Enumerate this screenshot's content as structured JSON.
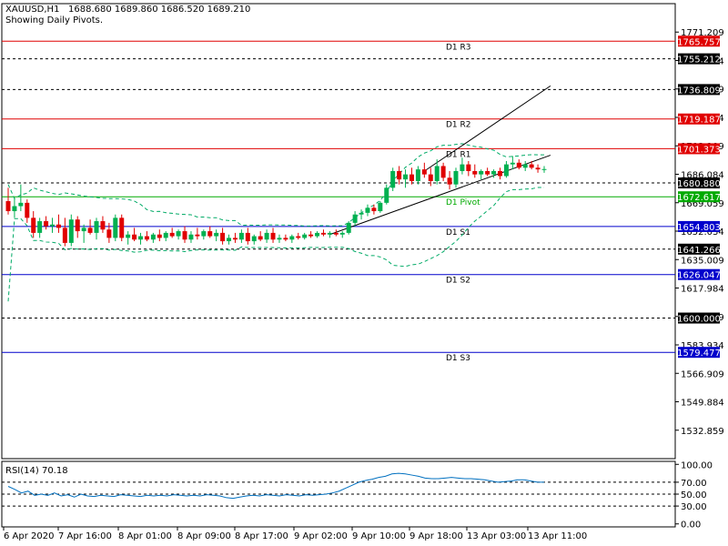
{
  "header": {
    "symbol": "XAUUSD,H1",
    "ohlc": "1688.680 1689.860 1686.520 1689.210",
    "note": "Showing Daily Pivots."
  },
  "indicator": {
    "label": "RSI(14) 70.18"
  },
  "colors": {
    "bull": "#00b050",
    "bear": "#e00000",
    "resistance": "#e00000",
    "support": "#0000cc",
    "pivot": "#00aa00",
    "dashed": "#000000",
    "band": "#00aa66",
    "rsi": "#0070c0"
  },
  "chart_data": [
    {
      "type": "candlestick",
      "title": "XAUUSD,H1",
      "ylim": [
        1515.84,
        1788.23
      ],
      "y_ticks": [
        "1771.209",
        "1754.184",
        "1737.159",
        "1720.134",
        "1703.109",
        "1686.084",
        "1669.059",
        "1652.034",
        "1635.009",
        "1617.984",
        "1600.959",
        "1583.934",
        "1566.909",
        "1549.884",
        "1532.859"
      ],
      "x_tick_labels": [
        "6 Apr 2020",
        "7 Apr 16:00",
        "8 Apr 01:00",
        "8 Apr 09:00",
        "8 Apr 17:00",
        "9 Apr 02:00",
        "9 Apr 10:00",
        "9 Apr 18:00",
        "13 Apr 03:00",
        "13 Apr 11:00"
      ],
      "pivot_levels": [
        {
          "name": "D1 R3",
          "value": 1765.757,
          "kind": "resistance"
        },
        {
          "name": "D1 R2",
          "value": 1719.187,
          "kind": "resistance"
        },
        {
          "name": "D1 R1",
          "value": 1701.373,
          "kind": "resistance"
        },
        {
          "name": "D1 Pivot",
          "value": 1672.617,
          "kind": "pivot"
        },
        {
          "name": "D1 S1",
          "value": 1654.803,
          "kind": "support"
        },
        {
          "name": "D1 S2",
          "value": 1626.047,
          "kind": "support"
        },
        {
          "name": "D1 S3",
          "value": 1579.477,
          "kind": "support"
        }
      ],
      "dashed_levels": [
        "1755.212",
        "1736.809",
        "1680.880",
        "1641.266",
        "1600.000"
      ],
      "candles": [
        [
          1670.0,
          1678.0,
          1662.0,
          1664.0
        ],
        [
          1664.0,
          1672.0,
          1660.0,
          1667.0
        ],
        [
          1667.0,
          1680.0,
          1664.0,
          1669.0
        ],
        [
          1669.0,
          1671.0,
          1657.0,
          1660.0
        ],
        [
          1660.0,
          1664.0,
          1648.0,
          1651.0
        ],
        [
          1651.0,
          1660.0,
          1648.0,
          1658.0
        ],
        [
          1658.0,
          1661.0,
          1653.0,
          1655.0
        ],
        [
          1655.0,
          1660.0,
          1651.0,
          1656.0
        ],
        [
          1656.0,
          1662.0,
          1651.0,
          1654.0
        ],
        [
          1654.0,
          1660.0,
          1643.0,
          1645.0
        ],
        [
          1645.0,
          1662.0,
          1643.0,
          1659.0
        ],
        [
          1659.0,
          1661.0,
          1648.0,
          1652.0
        ],
        [
          1652.0,
          1656.0,
          1645.0,
          1654.0
        ],
        [
          1654.0,
          1659.0,
          1650.0,
          1651.0
        ],
        [
          1651.0,
          1660.0,
          1647.0,
          1658.0
        ],
        [
          1658.0,
          1661.0,
          1651.0,
          1653.0
        ],
        [
          1653.0,
          1657.0,
          1645.0,
          1648.0
        ],
        [
          1648.0,
          1662.0,
          1646.0,
          1660.0
        ],
        [
          1660.0,
          1662.0,
          1646.0,
          1648.0
        ],
        [
          1648.0,
          1652.0,
          1644.0,
          1650.0
        ],
        [
          1650.0,
          1654.0,
          1646.0,
          1647.0
        ],
        [
          1647.0,
          1651.0,
          1644.0,
          1649.0
        ],
        [
          1649.0,
          1652.0,
          1646.0,
          1647.0
        ],
        [
          1647.0,
          1651.0,
          1645.0,
          1650.0
        ],
        [
          1650.0,
          1653.0,
          1646.0,
          1648.0
        ],
        [
          1648.0,
          1652.0,
          1646.0,
          1651.0
        ],
        [
          1651.0,
          1654.0,
          1648.0,
          1649.0
        ],
        [
          1649.0,
          1653.0,
          1647.0,
          1652.0
        ],
        [
          1652.0,
          1655.0,
          1645.0,
          1647.0
        ],
        [
          1647.0,
          1652.0,
          1645.0,
          1650.0
        ],
        [
          1650.0,
          1654.0,
          1647.0,
          1649.0
        ],
        [
          1649.0,
          1653.0,
          1647.0,
          1652.0
        ],
        [
          1652.0,
          1655.0,
          1648.0,
          1649.0
        ],
        [
          1649.0,
          1653.0,
          1646.0,
          1651.0
        ],
        [
          1651.0,
          1654.0,
          1644.0,
          1646.0
        ],
        [
          1646.0,
          1650.0,
          1644.0,
          1648.0
        ],
        [
          1648.0,
          1651.0,
          1645.0,
          1647.0
        ],
        [
          1647.0,
          1653.0,
          1645.0,
          1651.0
        ],
        [
          1651.0,
          1654.0,
          1644.0,
          1646.0
        ],
        [
          1646.0,
          1650.0,
          1644.0,
          1649.0
        ],
        [
          1649.0,
          1652.0,
          1646.0,
          1647.0
        ],
        [
          1647.0,
          1653.0,
          1645.0,
          1651.0
        ],
        [
          1651.0,
          1654.0,
          1645.0,
          1647.0
        ],
        [
          1647.0,
          1650.0,
          1645.0,
          1648.0
        ],
        [
          1648.0,
          1650.0,
          1646.0,
          1647.0
        ],
        [
          1647.0,
          1650.0,
          1645.0,
          1649.0
        ],
        [
          1649.0,
          1651.0,
          1647.0,
          1648.0
        ],
        [
          1648.0,
          1651.0,
          1647.0,
          1650.0
        ],
        [
          1650.0,
          1652.0,
          1648.0,
          1649.0
        ],
        [
          1649.0,
          1652.0,
          1648.0,
          1651.0
        ],
        [
          1651.0,
          1653.0,
          1649.0,
          1650.0
        ],
        [
          1650.0,
          1652.0,
          1648.0,
          1651.0
        ],
        [
          1651.0,
          1653.0,
          1649.0,
          1650.0
        ],
        [
          1650.0,
          1652.0,
          1648.0,
          1651.0
        ],
        [
          1651.0,
          1658.0,
          1650.0,
          1657.0
        ],
        [
          1657.0,
          1664.0,
          1655.0,
          1662.0
        ],
        [
          1662.0,
          1665.0,
          1659.0,
          1663.0
        ],
        [
          1663.0,
          1668.0,
          1661.0,
          1666.0
        ],
        [
          1666.0,
          1668.0,
          1662.0,
          1664.0
        ],
        [
          1664.0,
          1670.0,
          1663.0,
          1669.0
        ],
        [
          1669.0,
          1680.0,
          1668.0,
          1678.0
        ],
        [
          1678.0,
          1690.0,
          1676.0,
          1688.0
        ],
        [
          1688.0,
          1691.0,
          1680.0,
          1683.0
        ],
        [
          1683.0,
          1689.0,
          1678.0,
          1686.0
        ],
        [
          1686.0,
          1690.0,
          1680.0,
          1682.0
        ],
        [
          1682.0,
          1691.0,
          1680.0,
          1689.0
        ],
        [
          1689.0,
          1693.0,
          1684.0,
          1686.0
        ],
        [
          1686.0,
          1690.0,
          1679.0,
          1682.0
        ],
        [
          1682.0,
          1695.0,
          1680.0,
          1691.0
        ],
        [
          1691.0,
          1693.0,
          1682.0,
          1684.0
        ],
        [
          1684.0,
          1688.0,
          1677.0,
          1680.0
        ],
        [
          1680.0,
          1690.0,
          1678.0,
          1688.0
        ],
        [
          1688.0,
          1696.0,
          1686.0,
          1692.0
        ],
        [
          1692.0,
          1694.0,
          1685.0,
          1688.0
        ],
        [
          1688.0,
          1692.0,
          1684.0,
          1686.0
        ],
        [
          1686.0,
          1689.0,
          1683.0,
          1688.0
        ],
        [
          1688.0,
          1690.0,
          1685.0,
          1686.0
        ],
        [
          1686.0,
          1689.0,
          1684.0,
          1688.0
        ],
        [
          1688.0,
          1690.0,
          1683.0,
          1685.0
        ],
        [
          1685.0,
          1694.0,
          1684.0,
          1692.0
        ],
        [
          1692.0,
          1697.0,
          1689.0,
          1693.0
        ],
        [
          1693.0,
          1695.0,
          1689.0,
          1690.0
        ],
        [
          1690.0,
          1694.0,
          1688.0,
          1692.0
        ],
        [
          1692.0,
          1694.0,
          1689.0,
          1690.0
        ],
        [
          1690.0,
          1692.0,
          1687.0,
          1689.0
        ],
        [
          1689.0,
          1691.0,
          1687.0,
          1689.2
        ]
      ],
      "series": [
        {
          "name": "RSI(14)",
          "last": 70.18
        }
      ],
      "rsi_ticks": [
        "100.00",
        "70.00",
        "50.00",
        "30.00",
        "0.00"
      ],
      "rsi_ylim": [
        -5,
        105
      ],
      "rsi_values": [
        63,
        58,
        52,
        55,
        48,
        50,
        48,
        52,
        47,
        49,
        45,
        50,
        47,
        46,
        48,
        47,
        46,
        49,
        48,
        47,
        46,
        48,
        47,
        48,
        47,
        49,
        48,
        47,
        48,
        47,
        49,
        48,
        47,
        44,
        43,
        45,
        47,
        48,
        47,
        49,
        48,
        47,
        49,
        48,
        47,
        49,
        48,
        49,
        50,
        52,
        55,
        60,
        65,
        70,
        73,
        75,
        78,
        80,
        84,
        85,
        84,
        82,
        80,
        77,
        76,
        76,
        77,
        78,
        77,
        76,
        76,
        75,
        74,
        72,
        70,
        71,
        72,
        74,
        74,
        72,
        70,
        70
      ],
      "trendlines": {
        "upper": [
          [
            66,
            1688.0
          ],
          [
            86,
            1739.0
          ]
        ],
        "lower": [
          [
            51,
            1650.0
          ],
          [
            86,
            1697.5
          ]
        ]
      },
      "bands": {
        "upper_start": 1680.0,
        "lower_start": 1610.0
      }
    }
  ]
}
